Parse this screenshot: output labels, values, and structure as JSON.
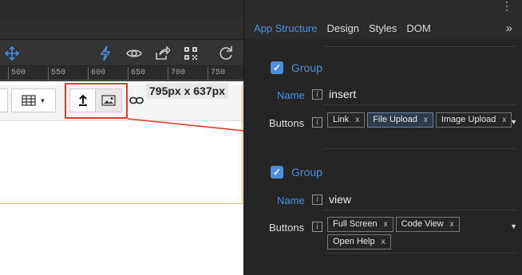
{
  "toolbar": {
    "icons": [
      "move-icon",
      "lightning-icon",
      "eye-icon",
      "share-icon",
      "qr-code-icon",
      "refresh-icon"
    ]
  },
  "ruler": {
    "ticks": [
      "500",
      "550",
      "600",
      "650",
      "700",
      "750"
    ]
  },
  "editor": {
    "size_label": "795px x 637px"
  },
  "panel": {
    "tabs": [
      "App Structure",
      "Design",
      "Styles",
      "DOM"
    ],
    "active_tab": "App Structure",
    "expand_glyph": "»",
    "groups": [
      {
        "label": "Group",
        "checked": true,
        "name_label": "Name",
        "name_value": "insert",
        "buttons_label": "Buttons",
        "buttons": [
          {
            "label": "Link",
            "remove": "x"
          },
          {
            "label": "File Upload",
            "remove": "x"
          },
          {
            "label": "Image Upload",
            "remove": "x"
          }
        ]
      },
      {
        "label": "Group",
        "checked": true,
        "name_label": "Name",
        "name_value": "view",
        "buttons_label": "Buttons",
        "buttons": [
          {
            "label": "Full Screen",
            "remove": "x"
          },
          {
            "label": "Code View",
            "remove": "x"
          },
          {
            "label": "Open Help",
            "remove": "x"
          }
        ]
      }
    ]
  },
  "colors": {
    "accent": "#4a90e2",
    "highlight": "#e53b2c"
  }
}
